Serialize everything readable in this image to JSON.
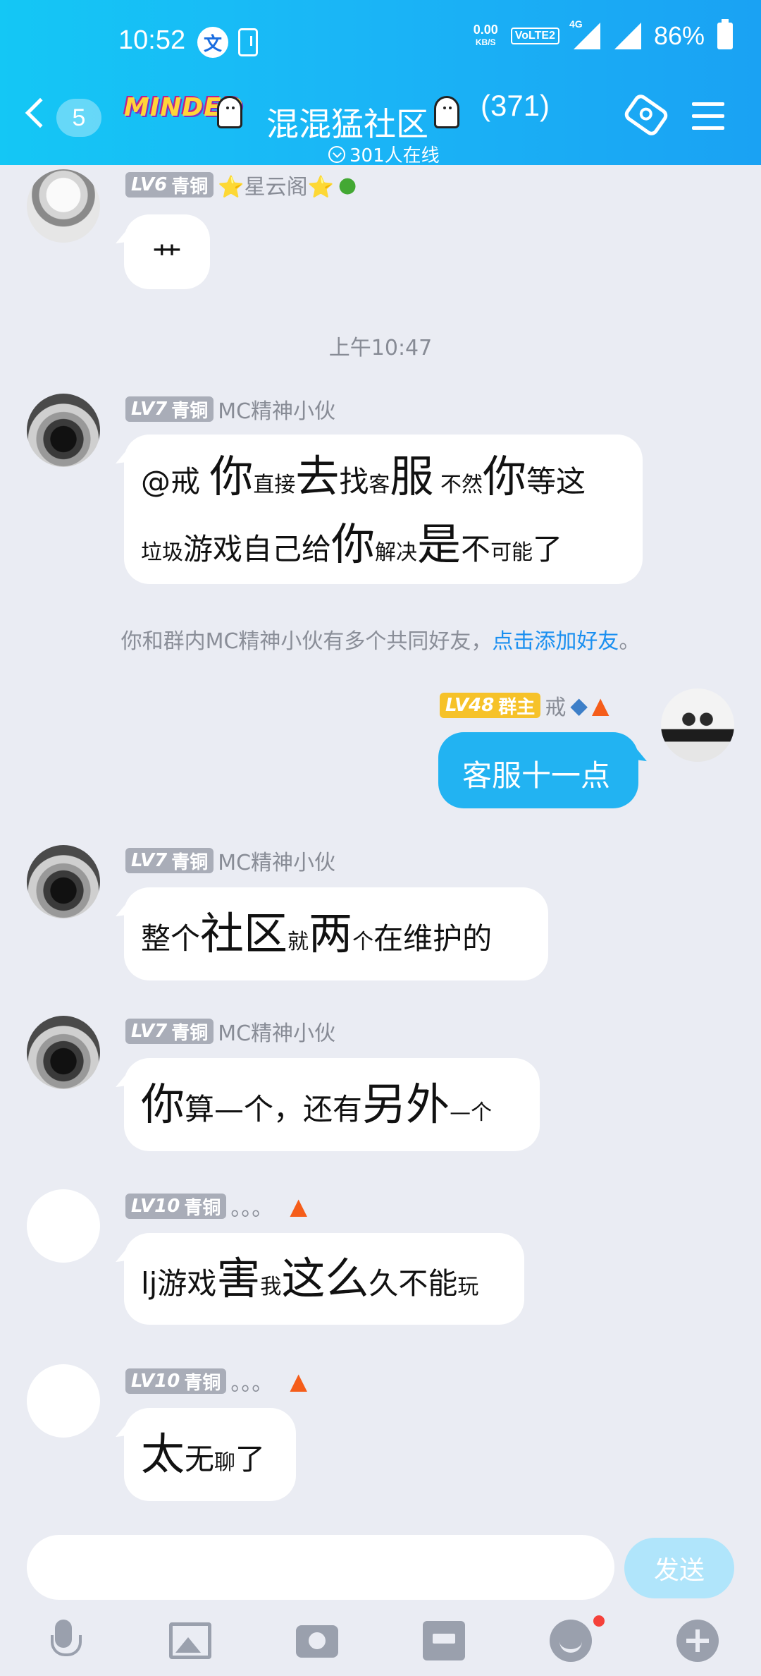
{
  "status": {
    "time": "10:52",
    "netspeed": "0.00",
    "netspeed_unit": "KB/S",
    "volte": "VoLTE2",
    "network": "4G",
    "battery": "86%"
  },
  "header": {
    "unread": "5",
    "brand": "MINDED",
    "title": "混混猛社区",
    "member_count": "(371)",
    "online": "301人在线"
  },
  "messages": [
    {
      "level": "LV6",
      "rank": "青铜",
      "name": "⭐星云阁⭐",
      "text": "艹"
    },
    {
      "level": "LV7",
      "rank": "青铜",
      "name": "MC精神小伙",
      "line1": [
        "@戒 ",
        "你",
        "直接",
        "去",
        "找",
        "客",
        "服",
        " 不然",
        "你",
        "等这"
      ],
      "line2": [
        "垃圾",
        "游戏自己给",
        "你",
        "解决",
        "是",
        "不",
        "可能",
        "了"
      ]
    },
    {
      "level": "LV48",
      "rank": "群主",
      "name": "戒",
      "text": "客服十一点"
    },
    {
      "level": "LV7",
      "rank": "青铜",
      "name": "MC精神小伙",
      "line1": [
        "整",
        "个",
        "社区",
        "就",
        "两",
        "个",
        "在维护的"
      ]
    },
    {
      "level": "LV7",
      "rank": "青铜",
      "name": "MC精神小伙",
      "line1": [
        "你",
        "算",
        "—个，还有",
        "另外",
        "—个"
      ]
    },
    {
      "level": "LV10",
      "rank": "青铜",
      "name": "。。。",
      "line1": [
        "lj游戏",
        "害",
        "我",
        "这么",
        "久不能",
        "玩"
      ]
    },
    {
      "level": "LV10",
      "rank": "青铜",
      "name": "。。。",
      "line1": [
        "太",
        "无",
        "聊",
        "了"
      ]
    }
  ],
  "timestamp": "上午10:47",
  "notice": {
    "text": "你和群内MC精神小伙有多个共同好友，",
    "link": "点击添加好友",
    "end": "。"
  },
  "input": {
    "placeholder": "",
    "send_label": "发送"
  },
  "toolbar": [
    "mic-icon",
    "image-icon",
    "camera-icon",
    "file-icon",
    "emoji-icon",
    "plus-icon"
  ]
}
